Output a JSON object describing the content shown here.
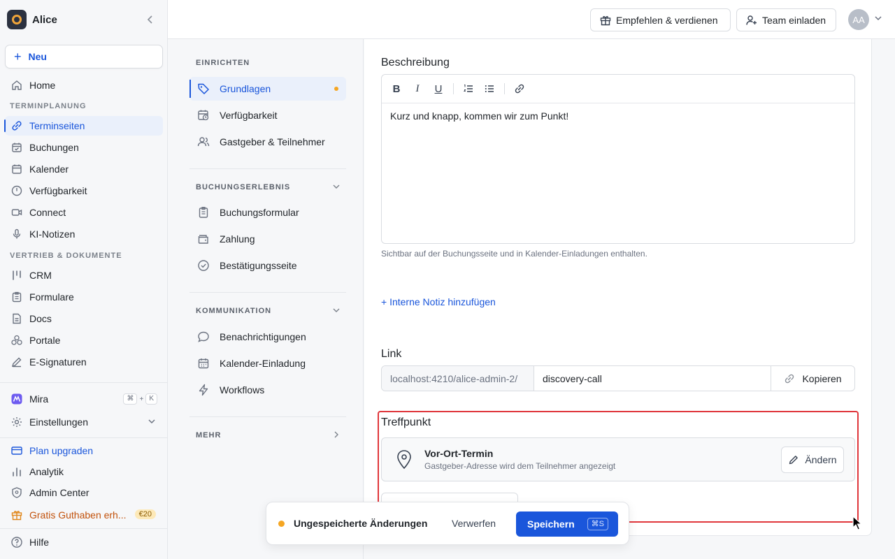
{
  "workspace": {
    "name": "Alice"
  },
  "sidebar": {
    "new_label": "Neu",
    "home": "Home",
    "section_scheduling": "TERMINPLANUNG",
    "items_scheduling": [
      {
        "label": "Terminseiten",
        "icon": "link-icon"
      },
      {
        "label": "Buchungen",
        "icon": "calendar-check-icon"
      },
      {
        "label": "Kalender",
        "icon": "calendar-icon"
      },
      {
        "label": "Verfügbarkeit",
        "icon": "clock-icon"
      },
      {
        "label": "Connect",
        "icon": "video-icon"
      },
      {
        "label": "KI-Notizen",
        "icon": "microphone-icon"
      }
    ],
    "section_sales": "VERTRIEB & DOKUMENTE",
    "items_sales": [
      {
        "label": "CRM",
        "icon": "crm-icon"
      },
      {
        "label": "Formulare",
        "icon": "clipboard-icon"
      },
      {
        "label": "Docs",
        "icon": "document-icon"
      },
      {
        "label": "Portale",
        "icon": "portal-icon"
      },
      {
        "label": "E-Signaturen",
        "icon": "pen-icon"
      }
    ],
    "mira": "Mira",
    "mira_shortcut": [
      "⌘",
      "+",
      "K"
    ],
    "settings": "Einstellungen",
    "upgrade": "Plan upgraden",
    "analytics": "Analytik",
    "admin": "Admin Center",
    "credit": "Gratis Guthaben erh...",
    "credit_badge": "€20",
    "help": "Hilfe"
  },
  "topbar": {
    "refer": "Empfehlen & verdienen",
    "invite": "Team einladen",
    "avatar": "AA"
  },
  "subnav": {
    "section_setup": "EINRICHTEN",
    "setup_items": [
      "Grundlagen",
      "Verfügbarkeit",
      "Gastgeber & Teilnehmer"
    ],
    "section_booking": "BUCHUNGSERLEBNIS",
    "booking_items": [
      "Buchungsformular",
      "Zahlung",
      "Bestätigungsseite"
    ],
    "section_comm": "KOMMUNIKATION",
    "comm_items": [
      "Benachrichtigungen",
      "Kalender-Einladung",
      "Workflows"
    ],
    "section_more": "MEHR"
  },
  "main": {
    "description_label": "Beschreibung",
    "description_text": "Kurz und knapp, kommen wir zum Punkt!",
    "description_hint": "Sichtbar auf der Buchungsseite und in Kalender-Einladungen enthalten.",
    "internal_note": "+ Interne Notiz hinzufügen",
    "link_label": "Link",
    "link_prefix": "localhost:4210/alice-admin-2/",
    "link_slug": "discovery-call",
    "copy": "Kopieren",
    "location_label": "Treffpunkt",
    "location_title": "Vor-Ort-Termin",
    "location_sub": "Gastgeber-Adresse wird dem Teilnehmer angezeigt",
    "change": "Ändern"
  },
  "savebar": {
    "status": "Ungespeicherte Änderungen",
    "discard": "Verwerfen",
    "save": "Speichern",
    "shortcut": "⌘S"
  },
  "colors": {
    "accent": "#1a56db",
    "warning": "#f5a623",
    "highlight": "#e0363b"
  }
}
